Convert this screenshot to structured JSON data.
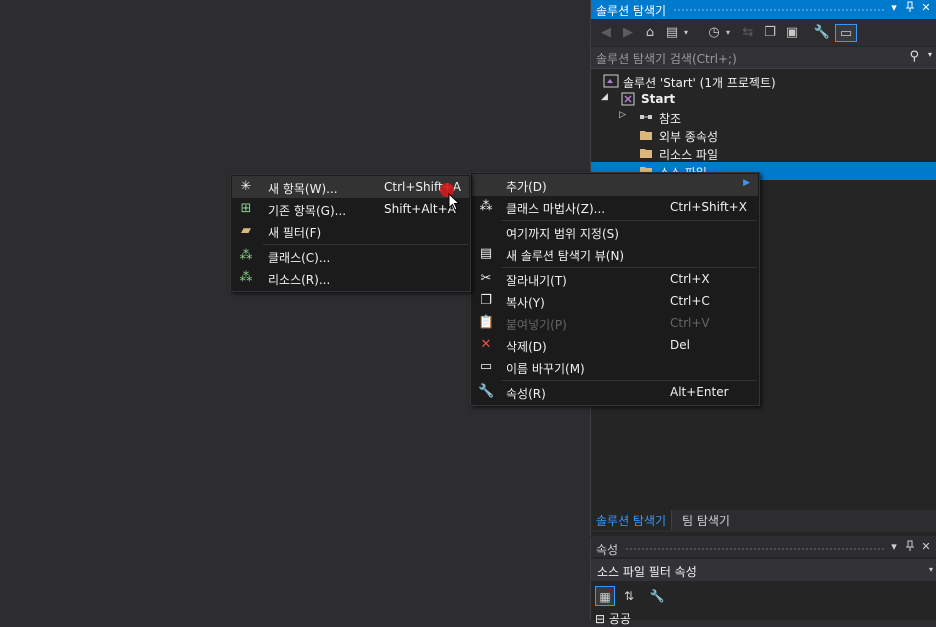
{
  "solution_explorer": {
    "title": "솔루션 탐색기",
    "search_placeholder": "솔루션 탐색기 검색(Ctrl+;)",
    "tree": [
      {
        "label": "솔루션 'Start' (1개 프로젝트)",
        "icon": "solution-icon"
      },
      {
        "label": "Start",
        "icon": "project-icon"
      },
      {
        "label": "참조",
        "icon": "references-icon"
      },
      {
        "label": "외부 종속성",
        "icon": "folder-icon"
      },
      {
        "label": "리소스 파일",
        "icon": "folder-icon"
      },
      {
        "label": "소스 파일",
        "icon": "folder-icon"
      }
    ],
    "tabs": [
      "솔루션 탐색기",
      "팀 탐색기"
    ]
  },
  "properties": {
    "title": "속성",
    "object": "소스 파일  필터 속성",
    "row": "⊟ 공공"
  },
  "context_menu": {
    "items": [
      {
        "label": "추가(D)",
        "shortcut": ""
      },
      {
        "label": "클래스 마법사(Z)...",
        "shortcut": "Ctrl+Shift+X"
      },
      {
        "label": "여기까지 범위 지정(S)",
        "shortcut": ""
      },
      {
        "label": "새 솔루션 탐색기 뷰(N)",
        "shortcut": ""
      },
      {
        "label": "잘라내기(T)",
        "shortcut": "Ctrl+X"
      },
      {
        "label": "복사(Y)",
        "shortcut": "Ctrl+C"
      },
      {
        "label": "붙여넣기(P)",
        "shortcut": "Ctrl+V"
      },
      {
        "label": "삭제(D)",
        "shortcut": "Del"
      },
      {
        "label": "이름 바꾸기(M)",
        "shortcut": ""
      },
      {
        "label": "속성(R)",
        "shortcut": "Alt+Enter"
      }
    ]
  },
  "add_submenu": {
    "items": [
      {
        "label": "새 항목(W)...",
        "shortcut": "Ctrl+Shift+A"
      },
      {
        "label": "기존 항목(G)...",
        "shortcut": "Shift+Alt+A"
      },
      {
        "label": "새 필터(F)",
        "shortcut": ""
      },
      {
        "label": "클래스(C)...",
        "shortcut": ""
      },
      {
        "label": "리소스(R)...",
        "shortcut": ""
      }
    ]
  },
  "colors": {
    "accent": "#007acc",
    "menu_bg": "#1b1b1c",
    "delete_red": "#e5534b"
  }
}
